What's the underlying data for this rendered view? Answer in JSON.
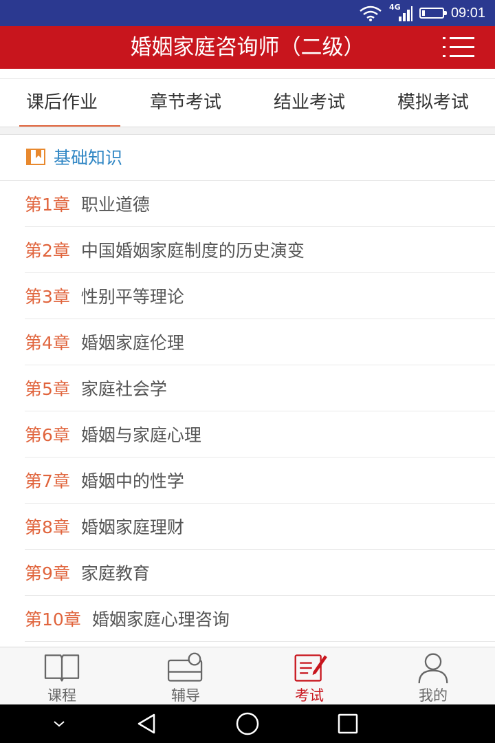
{
  "status_bar": {
    "time": "09:01",
    "network": "4G",
    "battery_level": 0.15
  },
  "header": {
    "title": "婚姻家庭咨询师（二级）"
  },
  "tabs": [
    {
      "label": "课后作业",
      "active": true
    },
    {
      "label": "章节考试",
      "active": false
    },
    {
      "label": "结业考试",
      "active": false
    },
    {
      "label": "模拟考试",
      "active": false
    }
  ],
  "section": {
    "title": "基础知识"
  },
  "chapters": [
    {
      "num": "第1章",
      "title": "职业道德"
    },
    {
      "num": "第2章",
      "title": "中国婚姻家庭制度的历史演变"
    },
    {
      "num": "第3章",
      "title": "性别平等理论"
    },
    {
      "num": "第4章",
      "title": "婚姻家庭伦理"
    },
    {
      "num": "第5章",
      "title": "家庭社会学"
    },
    {
      "num": "第6章",
      "title": "婚姻与家庭心理"
    },
    {
      "num": "第7章",
      "title": "婚姻中的性学"
    },
    {
      "num": "第8章",
      "title": "婚姻家庭理财"
    },
    {
      "num": "第9章",
      "title": "家庭教育"
    },
    {
      "num": "第10章",
      "title": "婚姻家庭心理咨询"
    }
  ],
  "bottom_nav": [
    {
      "label": "课程",
      "icon": "book-icon",
      "active": false
    },
    {
      "label": "辅导",
      "icon": "tutoring-icon",
      "active": false
    },
    {
      "label": "考试",
      "icon": "exam-icon",
      "active": true
    },
    {
      "label": "我的",
      "icon": "user-icon",
      "active": false
    }
  ],
  "colors": {
    "status_bar": "#2b3990",
    "title_bar": "#c8151d",
    "accent": "#e0643c",
    "section_title": "#2f86c4",
    "active_nav": "#c8151d"
  }
}
